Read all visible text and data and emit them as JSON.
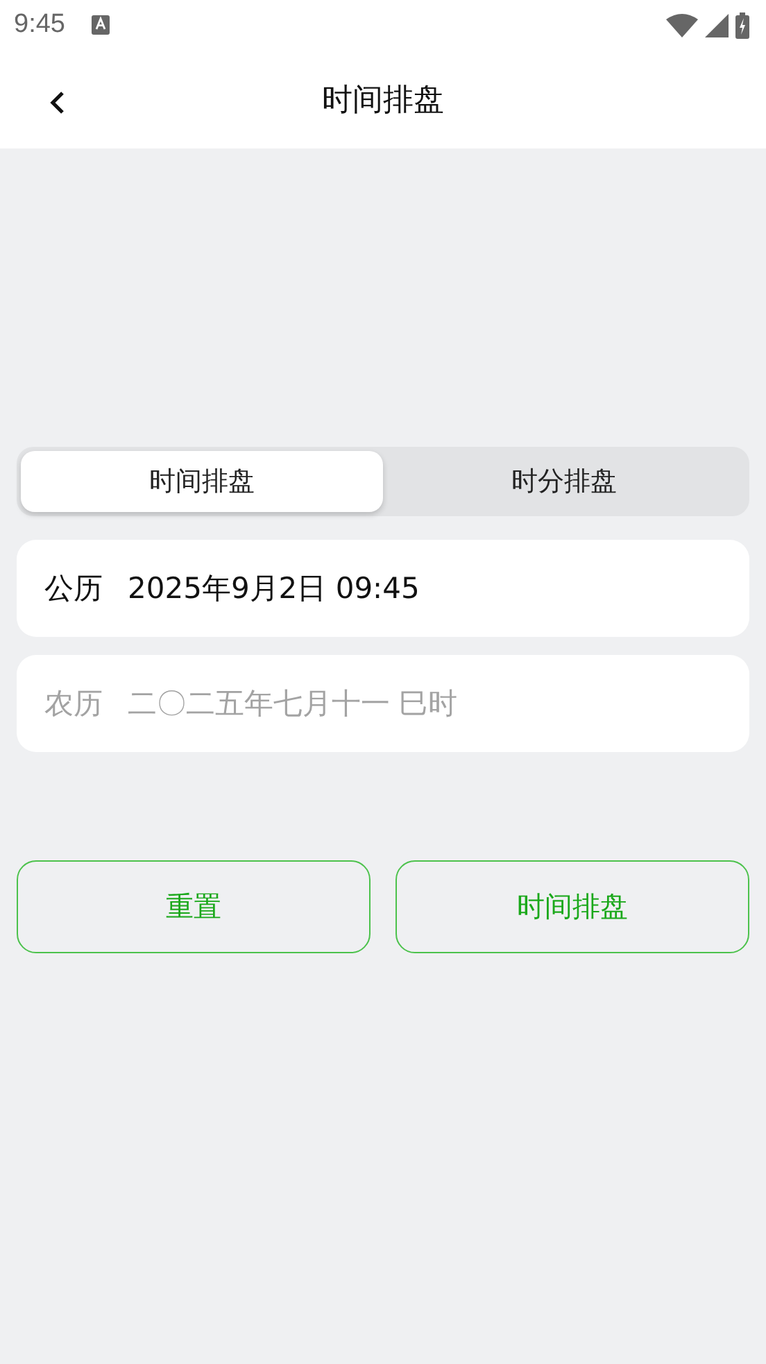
{
  "status_bar": {
    "time": "9:45"
  },
  "header": {
    "title": "时间排盘"
  },
  "tabs": [
    {
      "label": "时间排盘",
      "selected": true
    },
    {
      "label": "时分排盘",
      "selected": false
    }
  ],
  "date_rows": [
    {
      "label": "公历",
      "value": "2025年9月2日 09:45",
      "disabled": false
    },
    {
      "label": "农历",
      "value": "二〇二五年七月十一 巳时",
      "disabled": true
    }
  ],
  "buttons": [
    "重置",
    "时间排盘"
  ]
}
